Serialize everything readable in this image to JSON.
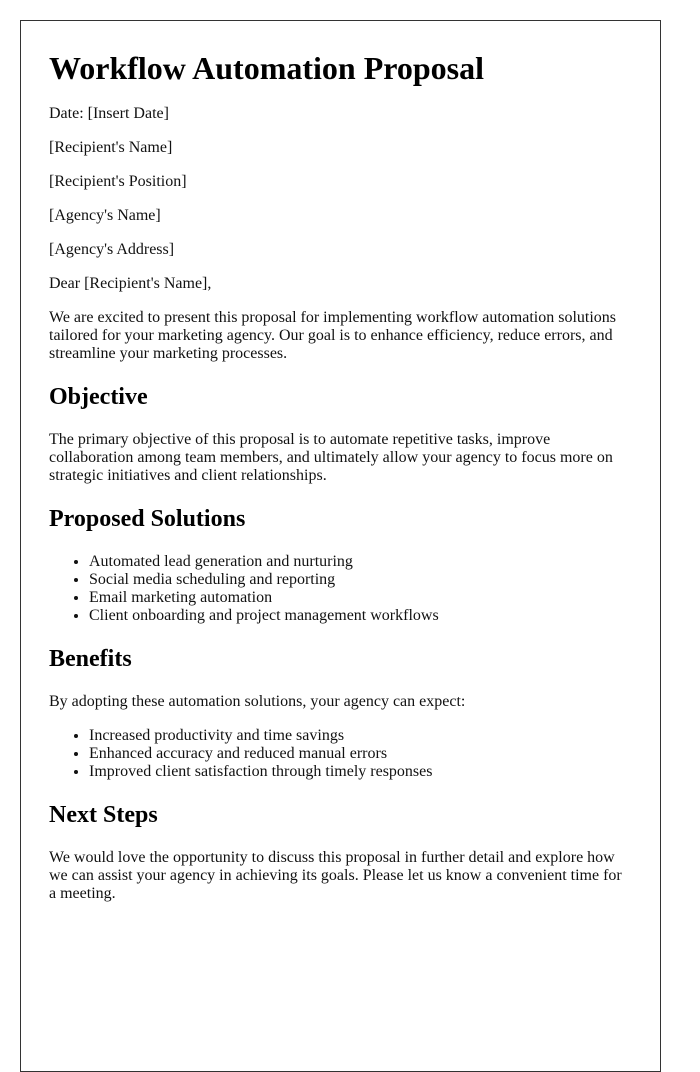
{
  "document": {
    "title": "Workflow Automation Proposal",
    "header_lines": [
      "Date: [Insert Date]",
      "[Recipient's Name]",
      "[Recipient's Position]",
      "[Agency's Name]",
      "[Agency's Address]"
    ],
    "salutation": "Dear [Recipient's Name],",
    "intro": "We are excited to present this proposal for implementing workflow automation solutions tailored for your marketing agency. Our goal is to enhance efficiency, reduce errors, and streamline your marketing processes.",
    "sections": {
      "objective": {
        "heading": "Objective",
        "text": "The primary objective of this proposal is to automate repetitive tasks, improve collaboration among team members, and ultimately allow your agency to focus more on strategic initiatives and client relationships."
      },
      "solutions": {
        "heading": "Proposed Solutions",
        "items": [
          "Automated lead generation and nurturing",
          "Social media scheduling and reporting",
          "Email marketing automation",
          "Client onboarding and project management workflows"
        ]
      },
      "benefits": {
        "heading": "Benefits",
        "intro": "By adopting these automation solutions, your agency can expect:",
        "items": [
          "Increased productivity and time savings",
          "Enhanced accuracy and reduced manual errors",
          "Improved client satisfaction through timely responses"
        ]
      },
      "next_steps": {
        "heading": "Next Steps",
        "text": "We would love the opportunity to discuss this proposal in further detail and explore how we can assist your agency in achieving its goals. Please let us know a convenient time for a meeting."
      }
    }
  }
}
